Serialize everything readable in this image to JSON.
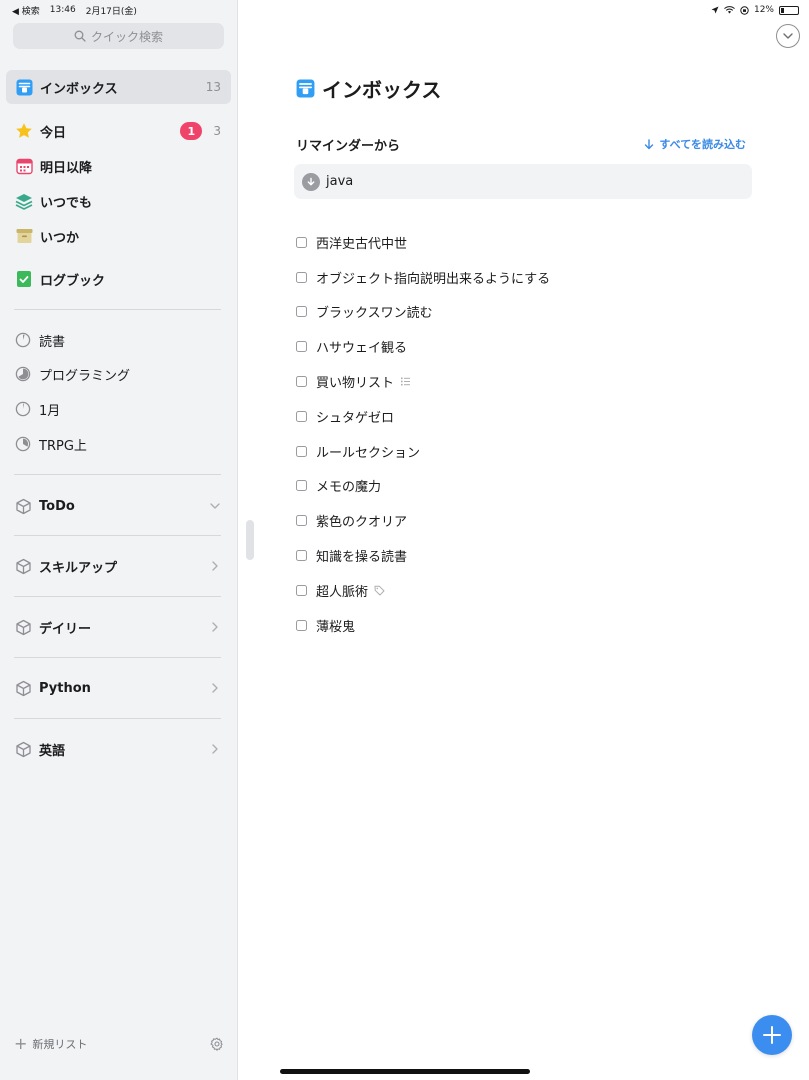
{
  "status_bar": {
    "back_label": "◀ 検索",
    "time": "13:46",
    "date": "2月17日(金)",
    "battery": "12%"
  },
  "sidebar": {
    "search_placeholder": "クイック検索",
    "nav": [
      {
        "label": "インボックス",
        "count": "13",
        "icon": "inbox-icon",
        "color": "#2f9ef4"
      },
      {
        "label": "今日",
        "badge": "1",
        "count": "3",
        "icon": "star-icon",
        "color": "#f7c21c"
      },
      {
        "label": "明日以降",
        "icon": "calendar-icon",
        "color": "#e8466d"
      },
      {
        "label": "いつでも",
        "icon": "layers-icon",
        "color": "#3aa88a"
      },
      {
        "label": "いつか",
        "icon": "archive-box-icon",
        "color": "#c9b56a"
      },
      {
        "label": "ログブック",
        "icon": "logbook-icon",
        "color": "#3cb95a"
      }
    ],
    "projects": [
      {
        "label": "読書",
        "icon": "pie-progress-icon"
      },
      {
        "label": "プログラミング",
        "icon": "pie-progress-icon"
      },
      {
        "label": "1月",
        "icon": "pie-progress-icon"
      },
      {
        "label": "TRPG上",
        "icon": "pie-progress-icon"
      }
    ],
    "areas": [
      {
        "label": "ToDo",
        "chevron": "chevron-down-icon"
      },
      {
        "label": "スキルアップ",
        "chevron": "chevron-right-icon"
      },
      {
        "label": "デイリー",
        "chevron": "chevron-right-icon"
      },
      {
        "label": "Python",
        "chevron": "chevron-right-icon"
      },
      {
        "label": "英語",
        "chevron": "chevron-right-icon"
      }
    ],
    "footer": {
      "new_list": "新規リスト"
    }
  },
  "main": {
    "title": "インボックス",
    "reminders_section": {
      "label": "リマインダーから",
      "load_all": "すべてを読み込む"
    },
    "reminder_item": "java",
    "tasks": [
      {
        "title": "西洋史古代中世"
      },
      {
        "title": "オブジェクト指向説明出来るようにする"
      },
      {
        "title": "ブラックスワン読む"
      },
      {
        "title": "ハサウェイ観る"
      },
      {
        "title": "買い物リスト",
        "meta_icon": "checklist-icon"
      },
      {
        "title": "シュタゲゼロ"
      },
      {
        "title": "ルールセクション"
      },
      {
        "title": "メモの魔力"
      },
      {
        "title": "紫色のクオリア"
      },
      {
        "title": "知識を操る読書"
      },
      {
        "title": "超人脈術",
        "meta_icon": "tag-icon"
      },
      {
        "title": "薄桜鬼"
      }
    ],
    "accent_color": "#3b8ef0"
  }
}
